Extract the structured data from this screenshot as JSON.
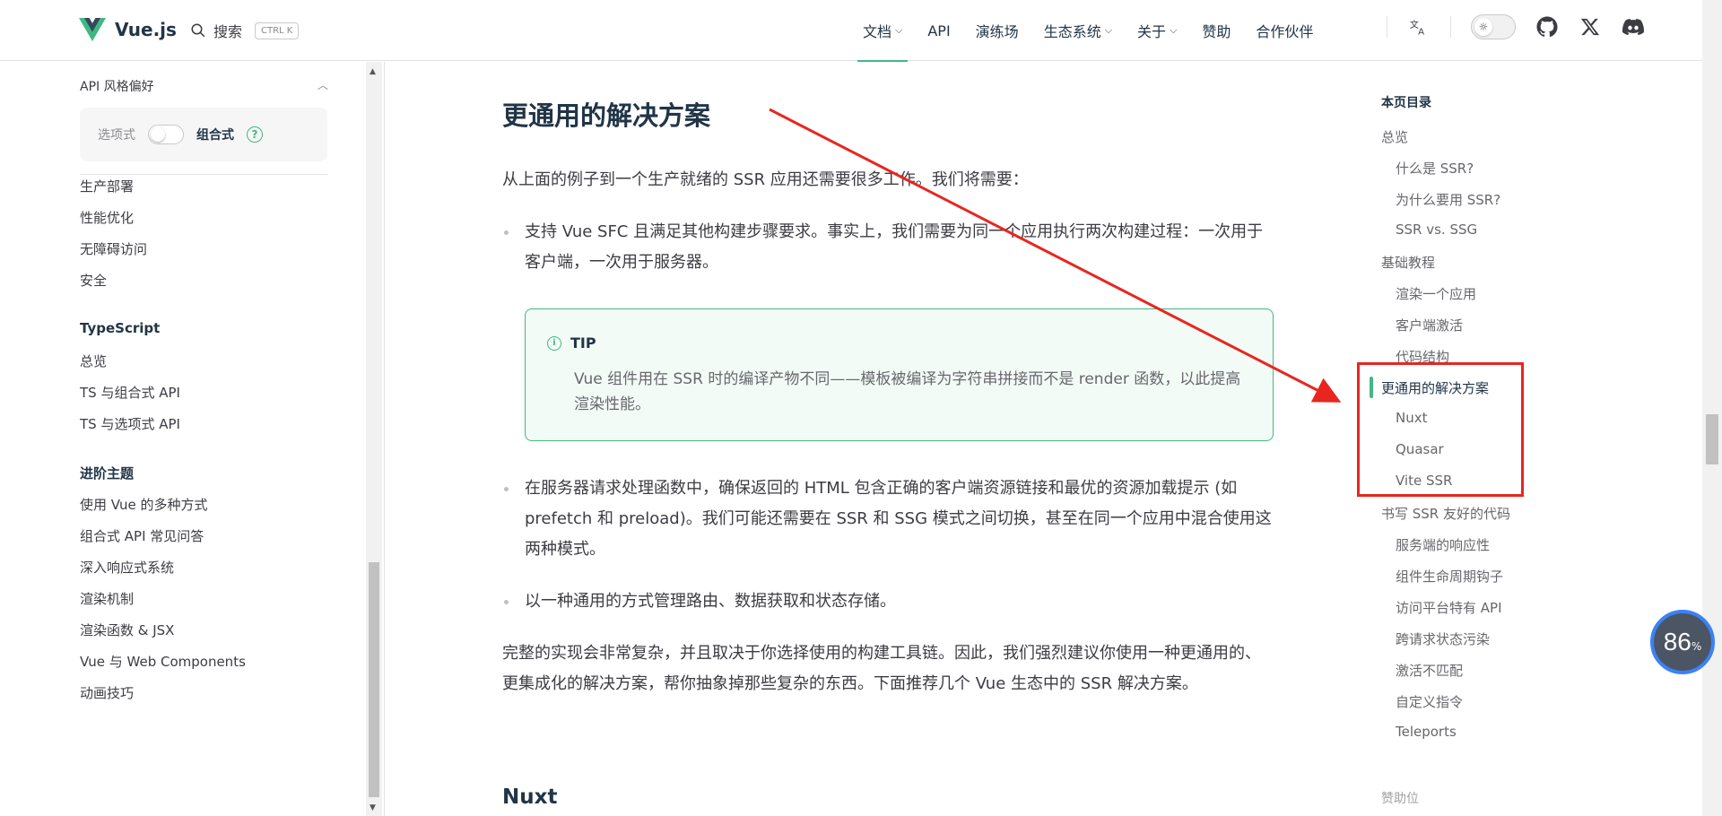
{
  "header": {
    "logo_text": "Vue.js",
    "search_label": "搜索",
    "search_kbd": "CTRL K",
    "nav": [
      {
        "label": "文档",
        "dropdown": true,
        "active": true
      },
      {
        "label": "API",
        "dropdown": false
      },
      {
        "label": "演练场",
        "dropdown": false
      },
      {
        "label": "生态系统",
        "dropdown": true
      },
      {
        "label": "关于",
        "dropdown": true
      },
      {
        "label": "赞助",
        "dropdown": false
      },
      {
        "label": "合作伙伴",
        "dropdown": false
      }
    ],
    "icons": [
      "translate-icon",
      "theme-switch",
      "github-icon",
      "x-icon",
      "discord-icon"
    ]
  },
  "sidebar": {
    "api_pref_title": "API 风格偏好",
    "api_option_label": "选项式",
    "api_composition_label": "组合式",
    "api_help": "?",
    "items_top": [
      "生产部署",
      "性能优化",
      "无障碍访问",
      "安全"
    ],
    "group_typescript": "TypeScript",
    "items_typescript": [
      "总览",
      "TS 与组合式 API",
      "TS 与选项式 API"
    ],
    "group_advanced": "进阶主题",
    "items_advanced": [
      "使用 Vue 的多种方式",
      "组合式 API 常见问答",
      "深入响应式系统",
      "渲染机制",
      "渲染函数 & JSX",
      "Vue 与 Web Components",
      "动画技巧"
    ]
  },
  "main": {
    "heading": "更通用的解决方案",
    "intro": "从上面的例子到一个生产就绪的 SSR 应用还需要很多工作。我们将需要：",
    "bullet1": "支持 Vue SFC 且满足其他构建步骤要求。事实上，我们需要为同一个应用执行两次构建过程：一次用于客户端，一次用于服务器。",
    "tip_title": "TIP",
    "tip_body": "Vue 组件用在 SSR 时的编译产物不同——模板被编译为字符串拼接而不是 render 函数，以此提高渲染性能。",
    "bullet2": "在服务器请求处理函数中，确保返回的 HTML 包含正确的客户端资源链接和最优的资源加载提示 (如 prefetch 和 preload)。我们可能还需要在 SSR 和 SSG 模式之间切换，甚至在同一个应用中混合使用这两种模式。",
    "bullet3": "以一种通用的方式管理路由、数据获取和状态存储。",
    "conclusion": "完整的实现会非常复杂，并且取决于你选择使用的构建工具链。因此，我们强烈建议你使用一种更通用的、更集成化的解决方案，帮你抽象掉那些复杂的东西。下面推荐几个 Vue 生态中的 SSR 解决方案。",
    "next_heading": "Nuxt"
  },
  "toc": {
    "title": "本页目录",
    "items": [
      {
        "label": "总览",
        "level": 1
      },
      {
        "label": "什么是 SSR?",
        "level": 2
      },
      {
        "label": "为什么要用 SSR?",
        "level": 2
      },
      {
        "label": "SSR vs. SSG",
        "level": 2
      },
      {
        "label": "基础教程",
        "level": 1
      },
      {
        "label": "渲染一个应用",
        "level": 2
      },
      {
        "label": "客户端激活",
        "level": 2
      },
      {
        "label": "代码结构",
        "level": 2
      },
      {
        "label": "更通用的解决方案",
        "level": 1,
        "active": true
      },
      {
        "label": "Nuxt",
        "level": 2
      },
      {
        "label": "Quasar",
        "level": 2
      },
      {
        "label": "Vite SSR",
        "level": 2
      },
      {
        "label": "书写 SSR 友好的代码",
        "level": 1
      },
      {
        "label": "服务端的响应性",
        "level": 2
      },
      {
        "label": "组件生命周期钩子",
        "level": 2
      },
      {
        "label": "访问平台特有 API",
        "level": 2
      },
      {
        "label": "跨请求状态污染",
        "level": 2
      },
      {
        "label": "激活不匹配",
        "level": 2
      },
      {
        "label": "自定义指令",
        "level": 2
      },
      {
        "label": "Teleports",
        "level": 2
      }
    ],
    "sponsor_label": "赞助位"
  },
  "widget": {
    "score": "86",
    "unit": "%"
  },
  "colors": {
    "accent": "#42b883",
    "annotation": "#e8261f",
    "text": "#213547"
  }
}
